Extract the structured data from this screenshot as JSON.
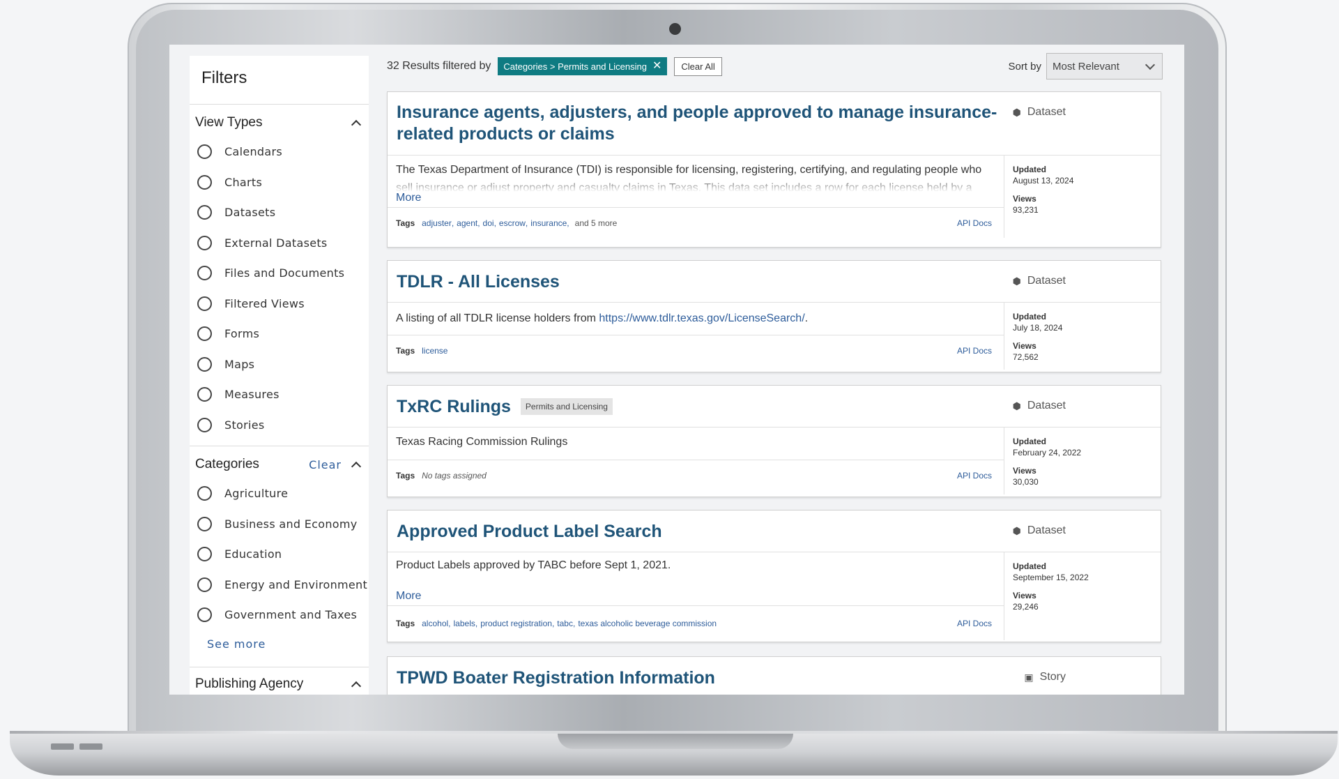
{
  "sidebar": {
    "title": "Filters",
    "view_types": {
      "title": "View Types",
      "options": [
        "Calendars",
        "Charts",
        "Datasets",
        "External Datasets",
        "Files and Documents",
        "Filtered Views",
        "Forms",
        "Maps",
        "Measures",
        "Stories"
      ]
    },
    "categories": {
      "title": "Categories",
      "clear_label": "Clear",
      "options": [
        "Agriculture",
        "Business and Economy",
        "Education",
        "Energy and Environment",
        "Government and Taxes"
      ],
      "see_more": "See more"
    },
    "publishing_agency": {
      "title": "Publishing Agency"
    }
  },
  "results": {
    "count_text": "32 Results filtered by",
    "filter_chip": "Categories > Permits and Licensing",
    "chip_close": "✕",
    "clear_all": "Clear All",
    "sort_label": "Sort by",
    "sort_value": "Most Relevant"
  },
  "cards": [
    {
      "title": "Insurance agents, adjusters, and people approved to manage insurance-related products or claims",
      "type": "Dataset",
      "type_icon": "dataset-icon",
      "description": "The Texas Department of Insurance (TDI) is responsible for licensing, registering, certifying, and regulating people who sell insurance or adjust property and casualty claims in Texas. This data set includes a row for each license held by a",
      "more": "More",
      "tags_label": "Tags",
      "tags": [
        "adjuster",
        "agent",
        "doi",
        "escrow",
        "insurance"
      ],
      "tags_extra": "and 5 more",
      "api_docs": "API Docs",
      "updated_label": "Updated",
      "updated": "August 13, 2024",
      "views_label": "Views",
      "views": "93,231"
    },
    {
      "title": "TDLR - All Licenses",
      "type": "Dataset",
      "type_icon": "dataset-icon",
      "description_prefix": "A listing of all TDLR license holders from ",
      "description_link": "https://www.tdlr.texas.gov/LicenseSearch/",
      "description_suffix": ".",
      "tags_label": "Tags",
      "tags": [
        "license"
      ],
      "api_docs": "API Docs",
      "updated_label": "Updated",
      "updated": "July 18, 2024",
      "views_label": "Views",
      "views": "72,562"
    },
    {
      "title": "TxRC Rulings",
      "category_badge": "Permits and Licensing",
      "type": "Dataset",
      "type_icon": "dataset-icon",
      "description": "Texas Racing Commission Rulings",
      "tags_label": "Tags",
      "no_tags": "No tags assigned",
      "api_docs": "API Docs",
      "updated_label": "Updated",
      "updated": "February 24, 2022",
      "views_label": "Views",
      "views": "30,030"
    },
    {
      "title": "Approved Product Label Search",
      "type": "Dataset",
      "type_icon": "dataset-icon",
      "description": "Product Labels approved by TABC before Sept 1, 2021.",
      "more": "More",
      "tags_label": "Tags",
      "tags": [
        "alcohol",
        "labels",
        "product registration",
        "tabc",
        "texas alcoholic beverage commission"
      ],
      "api_docs": "API Docs",
      "updated_label": "Updated",
      "updated": "September 15, 2022",
      "views_label": "Views",
      "views": "29,246"
    },
    {
      "title": "TPWD Boater Registration Information",
      "type": "Story",
      "type_icon": "story-icon"
    }
  ],
  "colors": {
    "title_blue": "#1f5478",
    "link_blue": "#2d5c9a",
    "chip_teal": "#0f7b82"
  }
}
